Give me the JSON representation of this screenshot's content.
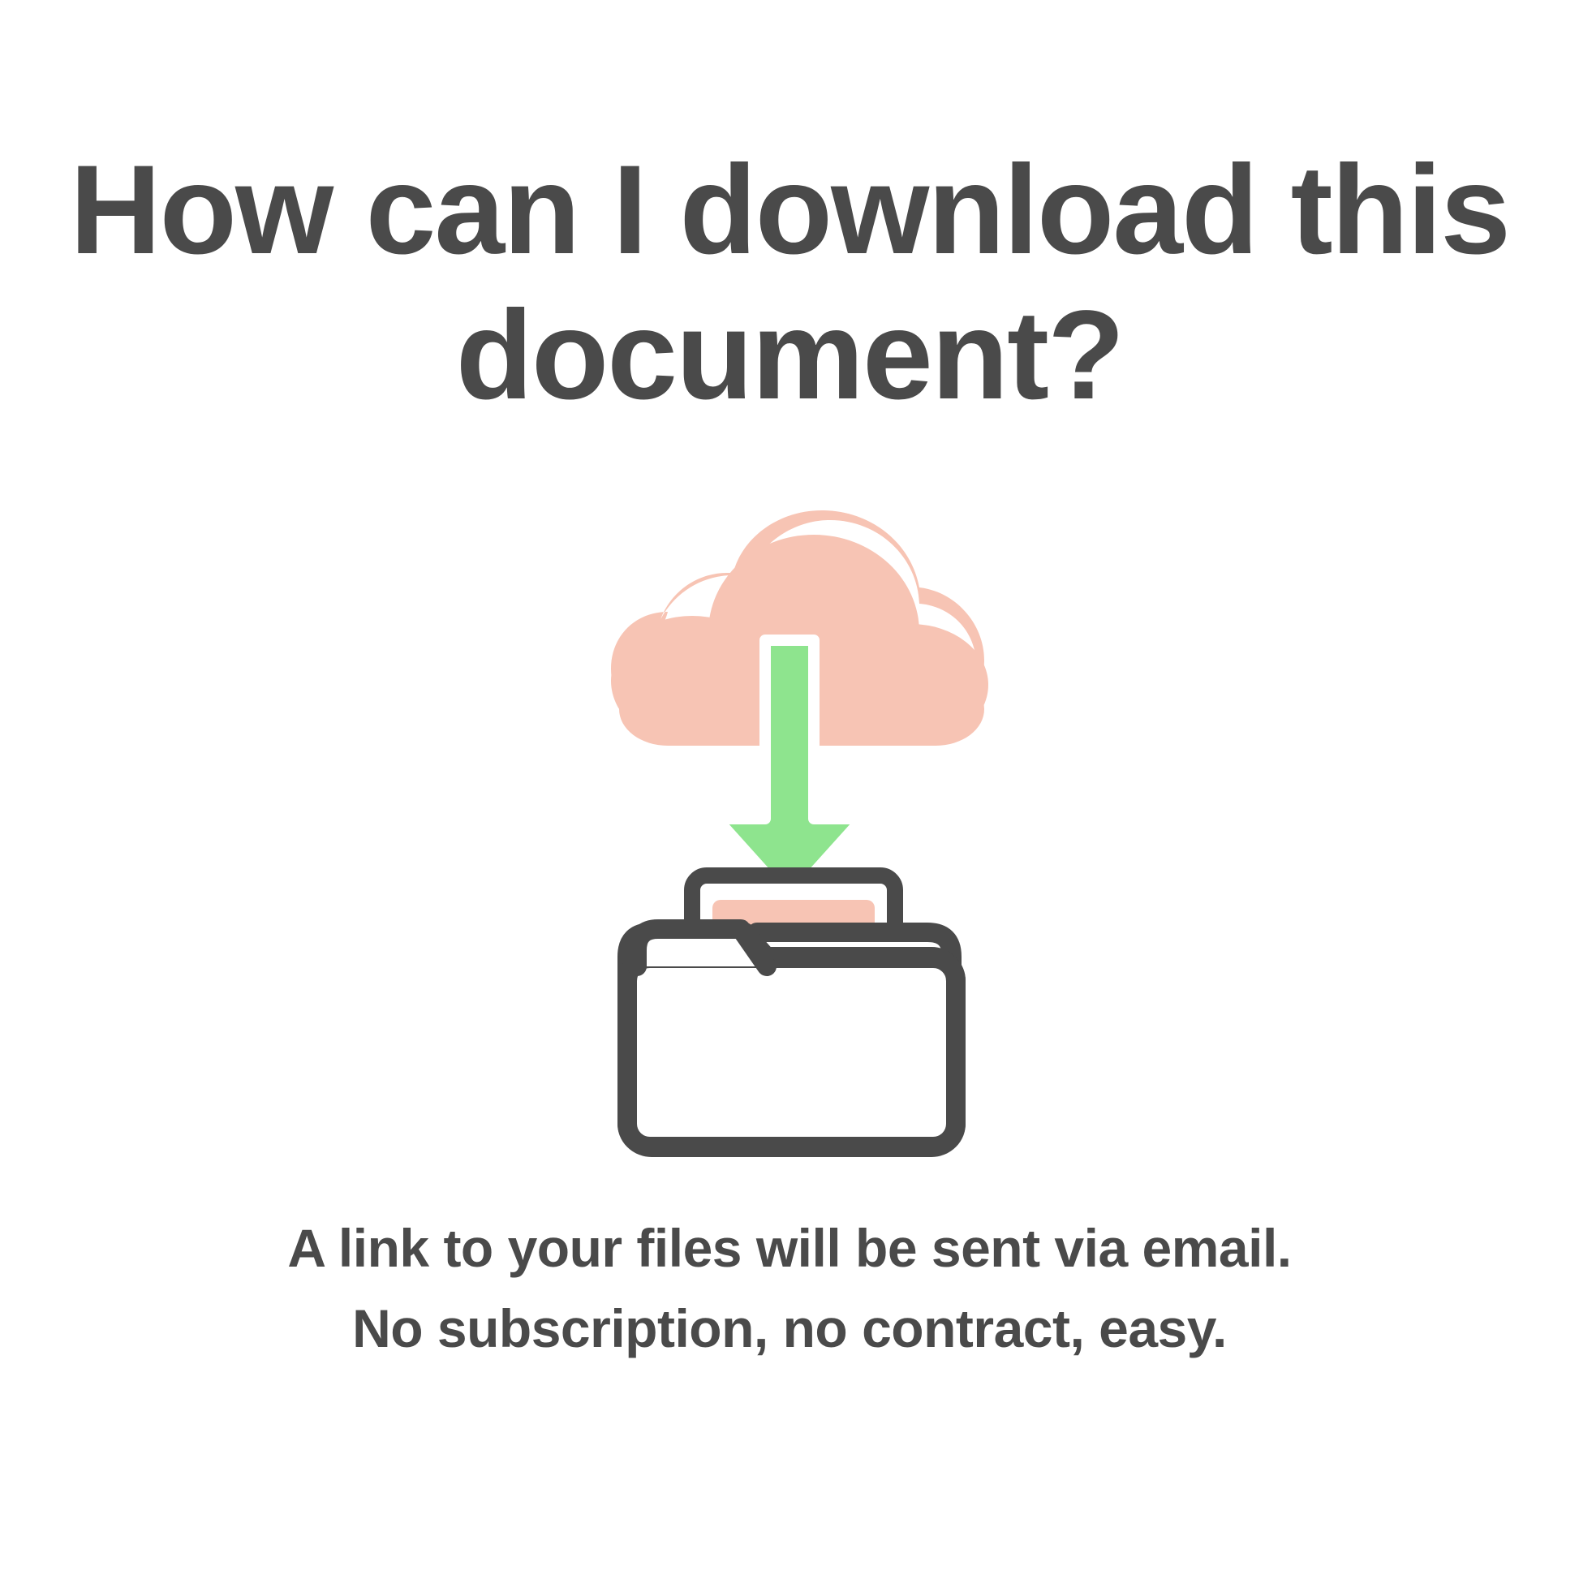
{
  "heading": "How can I download this document?",
  "subtext_line1": "A link to your files will be sent via email.",
  "subtext_line2": "No subscription, no contract, easy.",
  "colors": {
    "text": "#4a4a4a",
    "cloud": "#f7c4b4",
    "arrow": "#8ee48e",
    "folder_stroke": "#4a4a4a",
    "paper_fill": "#f7c4b4"
  }
}
